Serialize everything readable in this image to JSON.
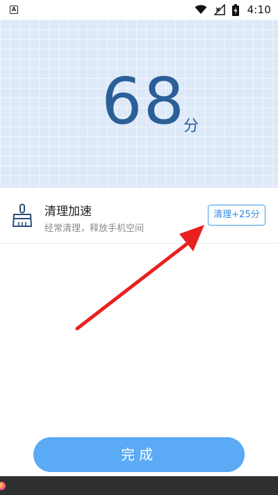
{
  "status_bar": {
    "time": "4:10",
    "app_badge": "A",
    "icons": [
      "wifi-icon",
      "signal-off-icon",
      "battery-charging-icon"
    ]
  },
  "score": {
    "value": "68",
    "unit": "分"
  },
  "clean": {
    "title": "清理加速",
    "subtitle": "经常清理，释放手机空间",
    "button_label": "清理+25分",
    "icon": "broom-icon"
  },
  "footer": {
    "done_label": "完成"
  },
  "colors": {
    "score_text": "#2b5f98",
    "accent": "#3f9bec",
    "done_button": "#5aaaf6",
    "arrow": "#e8211f"
  }
}
